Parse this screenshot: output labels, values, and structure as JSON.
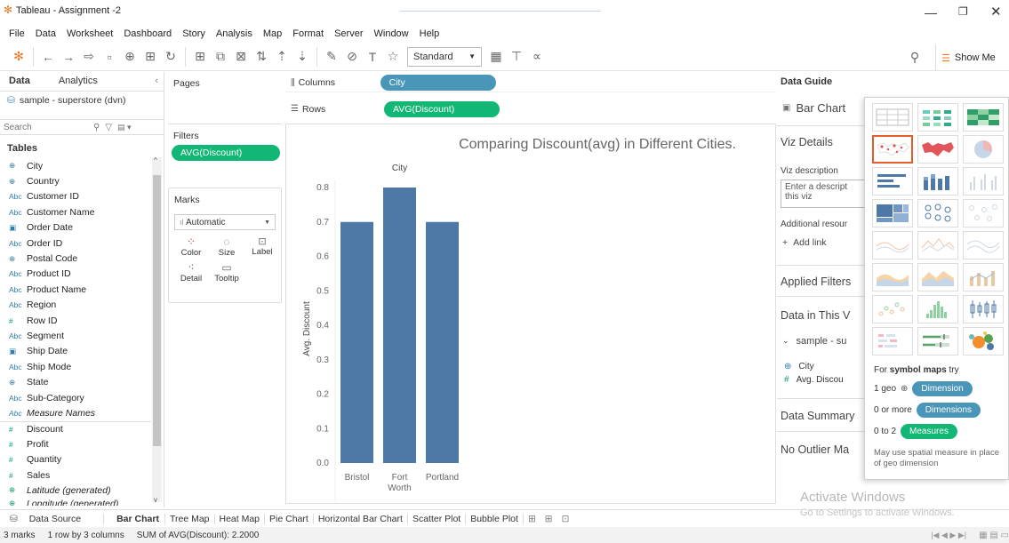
{
  "window": {
    "title": "Tableau - Assignment -2"
  },
  "menu": [
    "File",
    "Data",
    "Worksheet",
    "Dashboard",
    "Story",
    "Analysis",
    "Map",
    "Format",
    "Server",
    "Window",
    "Help"
  ],
  "toolbar": {
    "fit_mode": "Standard",
    "show_me": "Show Me"
  },
  "left": {
    "tab_data": "Data",
    "tab_analytics": "Analytics",
    "datasource": "sample - superstore (dvn)",
    "search_placeholder": "Search",
    "tables_label": "Tables",
    "fields": [
      {
        "type": "Dim",
        "icon": "globe",
        "name": "City"
      },
      {
        "type": "Dim",
        "icon": "globe",
        "name": "Country"
      },
      {
        "type": "Dim",
        "icon": "Abc",
        "name": "Customer ID"
      },
      {
        "type": "Dim",
        "icon": "Abc",
        "name": "Customer Name"
      },
      {
        "type": "Dim",
        "icon": "cal",
        "name": "Order Date"
      },
      {
        "type": "Dim",
        "icon": "Abc",
        "name": "Order ID"
      },
      {
        "type": "Dim",
        "icon": "globe",
        "name": "Postal Code"
      },
      {
        "type": "Dim",
        "icon": "Abc",
        "name": "Product ID"
      },
      {
        "type": "Dim",
        "icon": "Abc",
        "name": "Product Name"
      },
      {
        "type": "Dim",
        "icon": "Abc",
        "name": "Region"
      },
      {
        "type": "Mes",
        "icon": "#",
        "name": "Row ID"
      },
      {
        "type": "Dim",
        "icon": "Abc",
        "name": "Segment"
      },
      {
        "type": "Dim",
        "icon": "cal",
        "name": "Ship Date"
      },
      {
        "type": "Dim",
        "icon": "Abc",
        "name": "Ship Mode"
      },
      {
        "type": "Dim",
        "icon": "globe",
        "name": "State"
      },
      {
        "type": "Dim",
        "icon": "Abc",
        "name": "Sub-Category"
      },
      {
        "type": "Dim",
        "icon": "Abc",
        "name": "Measure Names"
      },
      {
        "type": "Mes",
        "icon": "#",
        "name": "Discount"
      },
      {
        "type": "Mes",
        "icon": "#",
        "name": "Profit"
      },
      {
        "type": "Mes",
        "icon": "#",
        "name": "Quantity"
      },
      {
        "type": "Mes",
        "icon": "#",
        "name": "Sales"
      },
      {
        "type": "Mes",
        "icon": "globe",
        "name": "Latitude (generated)"
      },
      {
        "type": "Mes",
        "icon": "globe",
        "name": "Longitude (generated)"
      }
    ]
  },
  "cards": {
    "pages": "Pages",
    "filters": "Filters",
    "filter_pill": "AVG(Discount)",
    "marks": "Marks",
    "mark_type": "Automatic",
    "mark_buttons": [
      "Color",
      "Size",
      "Label",
      "Detail",
      "Tooltip"
    ]
  },
  "shelves": {
    "columns_label": "Columns",
    "columns_pill": "City",
    "rows_label": "Rows",
    "rows_pill": "AVG(Discount)"
  },
  "chart_data": {
    "type": "bar",
    "title": "Comparing Discount(avg) in Different Cities.",
    "header": "City",
    "categories": [
      "Bristol",
      "Fort Worth",
      "Portland"
    ],
    "category_lines": [
      [
        "Bristol"
      ],
      [
        "Fort",
        "Worth"
      ],
      [
        "Portland"
      ]
    ],
    "values": [
      0.7,
      0.8,
      0.7
    ],
    "ylabel": "Avg. Discount",
    "ylim": [
      0,
      0.85
    ],
    "yticks": [
      "0.0",
      "0.1",
      "0.2",
      "0.3",
      "0.4",
      "0.5",
      "0.6",
      "0.7",
      "0.8"
    ],
    "ytick_values": [
      0,
      0.1,
      0.2,
      0.3,
      0.4,
      0.5,
      0.6,
      0.7,
      0.8
    ],
    "bar_color": "#4e79a7",
    "grid": false
  },
  "right": {
    "data_guide": "Data Guide",
    "chart_type": "Bar Chart",
    "viz_details": "Viz Details",
    "viz_description": "Viz description",
    "desc_placeholder": "Enter a descript this viz",
    "additional": "Additional resour",
    "add_link": "Add link",
    "applied_filters": "Applied Filters",
    "data_in_view": "Data in This V",
    "source_short": "sample - su",
    "view_fields": [
      "City",
      "Avg. Discou"
    ],
    "data_summary": "Data Summary",
    "no_outlier": "No Outlier Ma"
  },
  "showme": {
    "hint_prefix": "For ",
    "hint_bold": "symbol maps",
    "hint_suffix": " try",
    "req1_label": "1 geo",
    "req1_pill": "Dimension",
    "req2_label": "0 or more",
    "req2_pill": "Dimensions",
    "req3_label": "0 to 2",
    "req3_pill": "Measures",
    "note": "May use spatial measure in place of geo dimension"
  },
  "watermark": {
    "line1": "Activate Windows",
    "line2": "Go to Settings to activate Windows."
  },
  "sheets": {
    "datasource": "Data Source",
    "tabs": [
      "Bar Chart",
      "Tree Map",
      "Heat Map",
      "Pie Chart",
      "Horizontal Bar Chart",
      "Scatter Plot",
      "Bubble Plot"
    ]
  },
  "status": {
    "marks": "3 marks",
    "dims": "1 row by 3 columns",
    "sum": "SUM of AVG(Discount): 2.2000"
  }
}
